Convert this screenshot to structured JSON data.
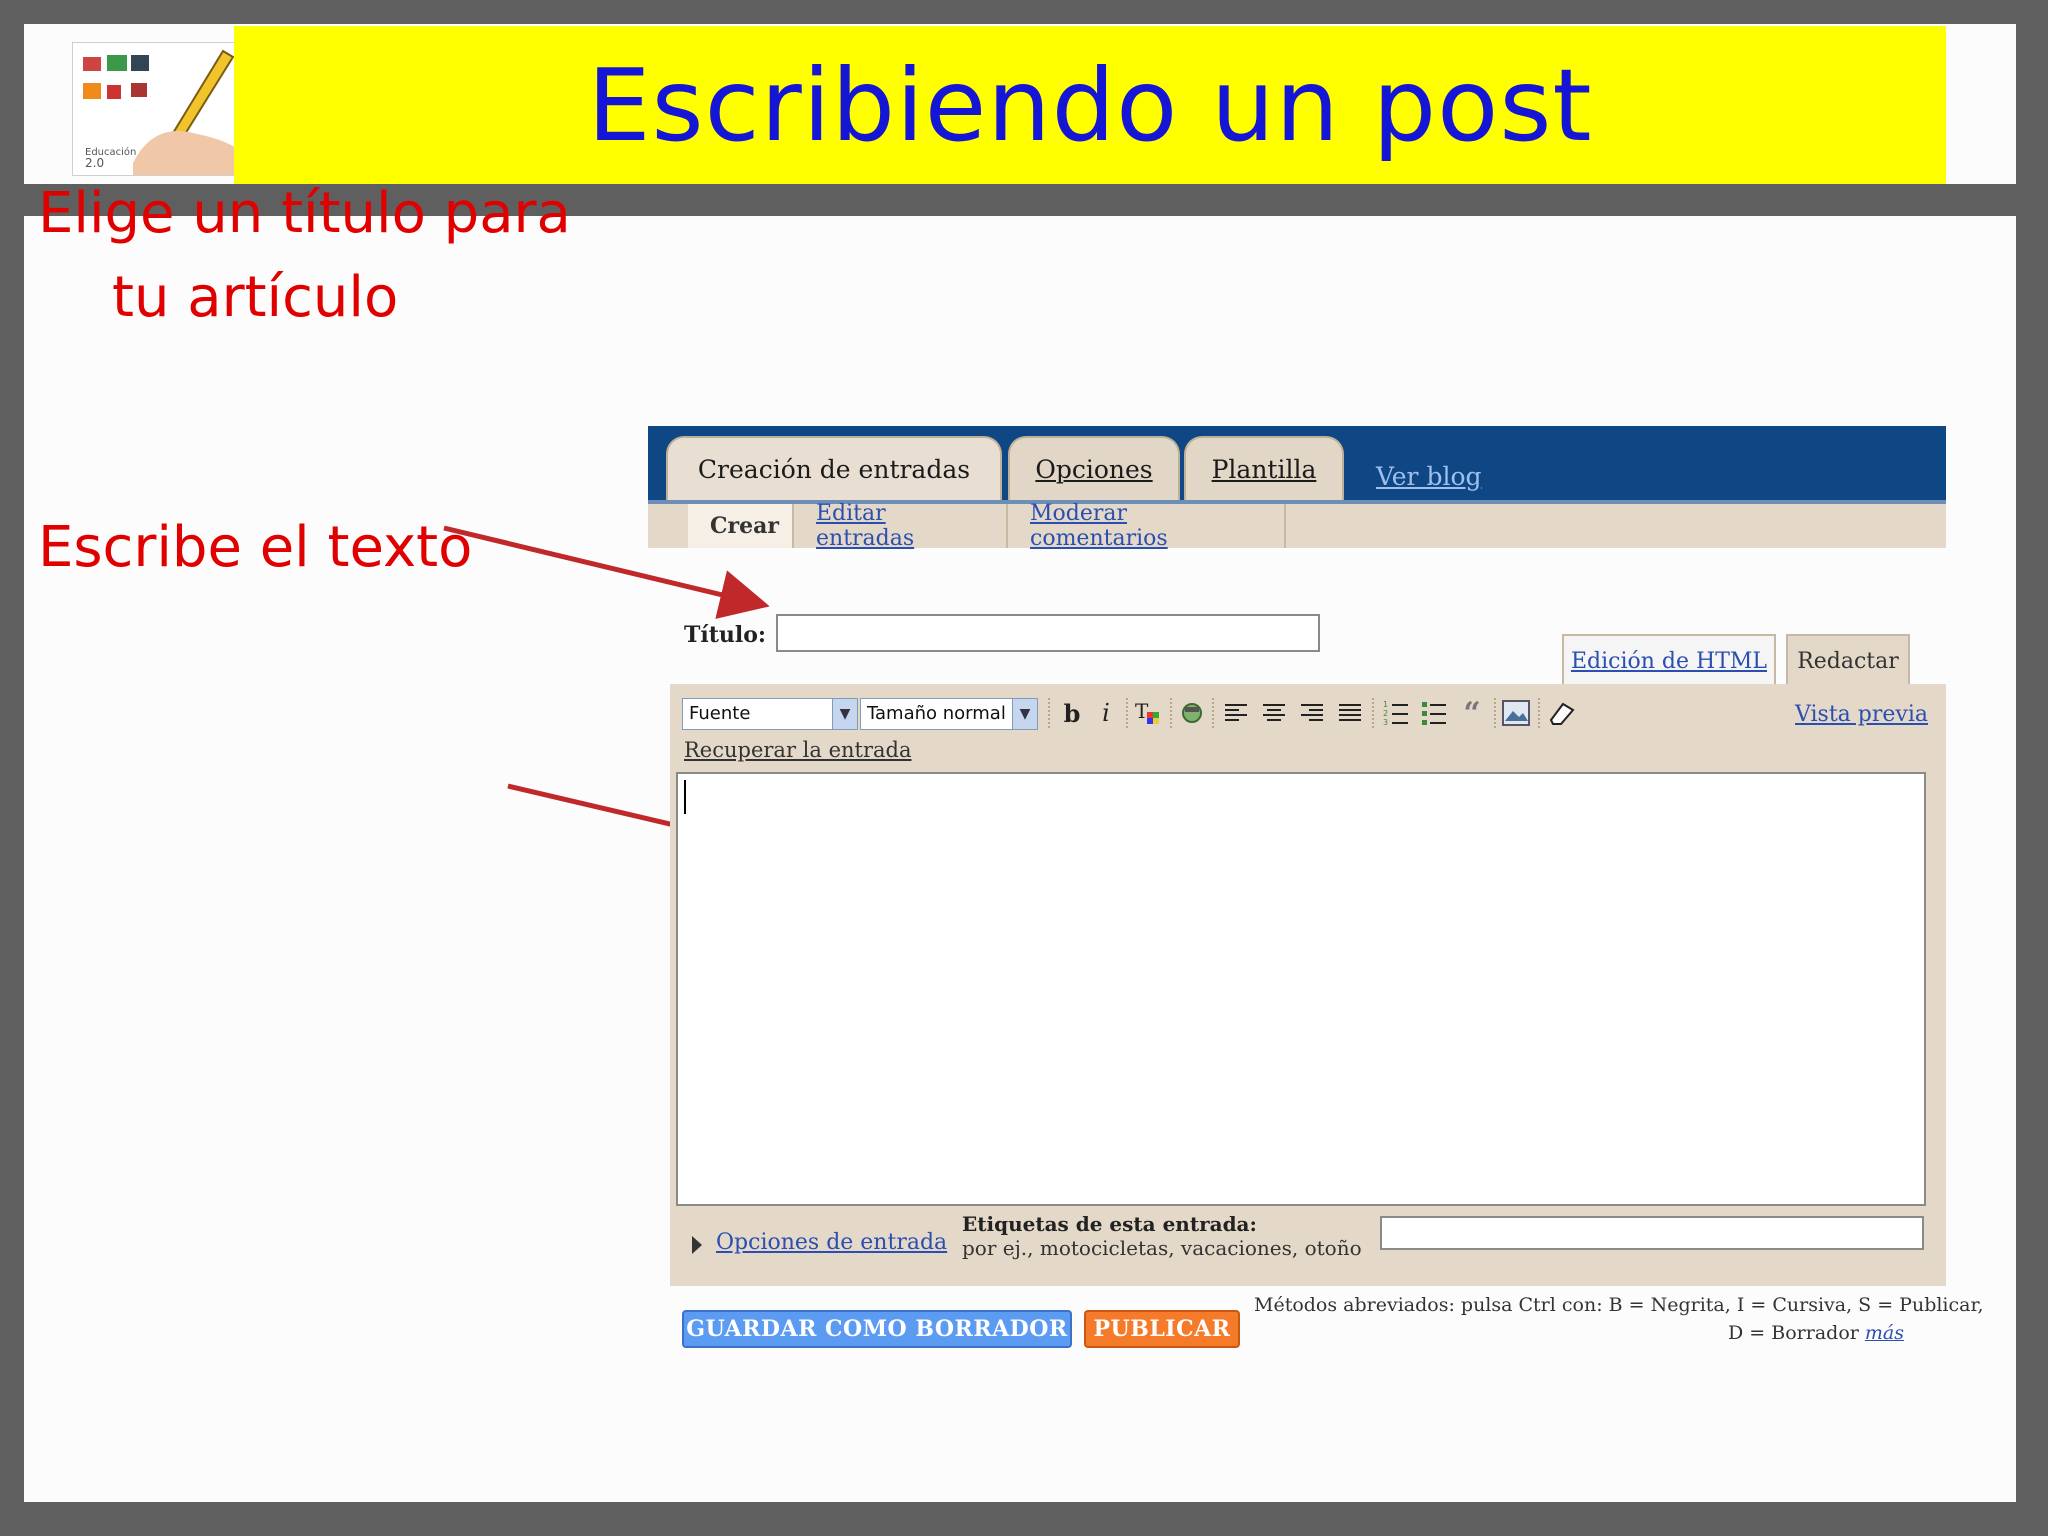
{
  "slide": {
    "title": "Escribiendo un post",
    "callout_title_line1": "Elige un título para",
    "callout_title_line2": "tu artículo",
    "callout_text": "Escribe el texto",
    "colors": {
      "title": "#1515d6",
      "title_band": "#ffff00",
      "callout": "#e00000",
      "arrow": "#c0282a"
    }
  },
  "blogger": {
    "tabs": [
      {
        "label": "Creación de entradas",
        "active": true
      },
      {
        "label": "Opciones",
        "active": false
      },
      {
        "label": "Plantilla",
        "active": false
      }
    ],
    "view_blog": "Ver blog",
    "subnav": {
      "crear": "Crear",
      "editar": "Editar entradas",
      "moderar": "Moderar comentarios"
    },
    "titulo_label": "Título:",
    "titulo_value": "",
    "mode_tabs": {
      "html": "Edición de HTML",
      "redactar": "Redactar"
    },
    "toolbar": {
      "font": "Fuente",
      "size": "Tamaño normal",
      "vista_previa": "Vista previa",
      "icons": [
        "bold-icon",
        "italic-icon",
        "text-color-icon",
        "link-icon",
        "align-left-icon",
        "align-center-icon",
        "align-right-icon",
        "justify-icon",
        "numbered-list-icon",
        "bullet-list-icon",
        "blockquote-icon",
        "insert-image-icon",
        "clear-format-icon"
      ]
    },
    "recuperar": "Recuperar la entrada",
    "opciones_entrada": "Opciones de entrada",
    "etiquetas_label": "Etiquetas de esta entrada:",
    "etiquetas_hint": "por ej., motocicletas, vacaciones, otoño",
    "etiquetas_value": "",
    "buttons": {
      "guardar": "GUARDAR COMO BORRADOR",
      "publicar": "PUBLICAR"
    },
    "shortcuts_line1": "Métodos abreviados: pulsa Ctrl con: B = Negrita, I = Cursiva, S = Publicar,",
    "shortcuts_line2": "D = Borrador",
    "shortcuts_more": "más"
  }
}
